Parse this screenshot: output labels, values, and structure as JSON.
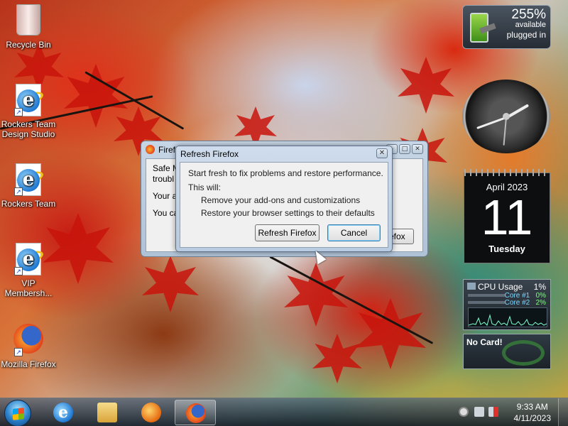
{
  "desktop": {
    "icons": [
      {
        "label": "Recycle Bin"
      },
      {
        "label": "Rockers Team Design Studio"
      },
      {
        "label": "Rockers Team"
      },
      {
        "label": "VIP Membersh..."
      },
      {
        "label": "Mozilla Firefox"
      }
    ]
  },
  "gadgets": {
    "battery": {
      "percent": "255%",
      "available": "available",
      "status": "plugged in"
    },
    "calendar": {
      "month": "April 2023",
      "day": "11",
      "weekday": "Tuesday"
    },
    "cpu": {
      "title": "CPU Usage",
      "total": "1%",
      "core1_label": "Core #1",
      "core1_value": "0%",
      "core2_label": "Core #2",
      "core2_value": "2%"
    },
    "nocard": {
      "label": "No Card!"
    }
  },
  "background_window": {
    "title": "Firefox",
    "line1": "Safe M",
    "line2": "troubl",
    "line3": "Your a",
    "line4": "You ca",
    "button_label": "efox"
  },
  "dialog": {
    "title": "Refresh Firefox",
    "message": "Start fresh to fix problems and restore performance.",
    "this_will": "This will:",
    "item1": "Remove your add-ons and customizations",
    "item2": "Restore your browser settings to their defaults",
    "refresh_button": "Refresh Firefox",
    "cancel_button": "Cancel"
  },
  "taskbar": {
    "time": "9:33 AM",
    "date": "4/11/2023"
  },
  "colors": {
    "accent": "#3c7fb1",
    "leaf": "#c8140c"
  }
}
